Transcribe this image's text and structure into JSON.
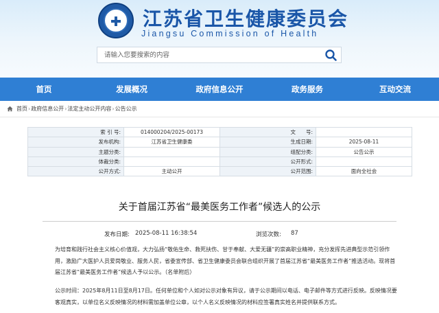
{
  "header": {
    "site_title": "江苏省卫生健康委员会",
    "site_subtitle": "Jiangsu Commission of Health",
    "emblem_icon": "emblem-icon"
  },
  "search": {
    "placeholder": "请输入您要搜索的内容",
    "icon": "search-icon"
  },
  "nav": {
    "items": [
      {
        "label": "首页"
      },
      {
        "label": "发展概况"
      },
      {
        "label": "政府信息公开"
      },
      {
        "label": "政务服务"
      },
      {
        "label": "互动交流"
      }
    ],
    "color": "#2f7fd4"
  },
  "breadcrumb": {
    "items": [
      "首页",
      "政府信息公开",
      "法定主动公开内容",
      "公告公示"
    ],
    "separator": "›"
  },
  "info_table": {
    "rows": [
      [
        {
          "k": "索 引 号:",
          "v": "014000204/2025-00173"
        },
        {
          "k": "文　　号:",
          "v": ""
        }
      ],
      [
        {
          "k": "发布机构:",
          "v": "江苏省卫生健康委"
        },
        {
          "k": "生成日期:",
          "v": "2025-08-11"
        }
      ],
      [
        {
          "k": "主题分类:",
          "v": ""
        },
        {
          "k": "组配分类:",
          "v": "公告公示"
        }
      ],
      [
        {
          "k": "体裁分类:",
          "v": ""
        },
        {
          "k": "公开形式:",
          "v": ""
        }
      ],
      [
        {
          "k": "公开方式:",
          "v": "主动公开"
        },
        {
          "k": "公开范围:",
          "v": "面向全社会"
        }
      ]
    ]
  },
  "article": {
    "title": "关于首届江苏省“最美医务工作者”候选人的公示",
    "publish_label": "发布日期:",
    "publish_date": "2025-08-11 16:38:54",
    "views_label": "浏览次数:",
    "views": "87",
    "paragraph1": "为培育和践行社会主义核心价值观，大力弘扬“敬佑生命、救死扶伤、甘于奉献、大爱无疆”的崇高职业精神，充分发挥先进典型示范引领作用，激励广大医护人员爱岗敬业、服务人民，省委宣传部、省卫生健康委员会联合组织开展了首届江苏省“最美医务工作者”推选活动。现将首届江苏省“最美医务工作者”候选人予以公示。（名单附后）",
    "paragraph2": "公示时间：2025年8月11日至8月17日。任何单位和个人如对公示对象有异议，请于公示期间以电话、电子邮件等方式进行反映。反映情况要客观真实，以单位名义反映情况的材料需加盖单位公章，以个人名义反映情况的材料应签署真实姓名并提供联系方式。"
  }
}
